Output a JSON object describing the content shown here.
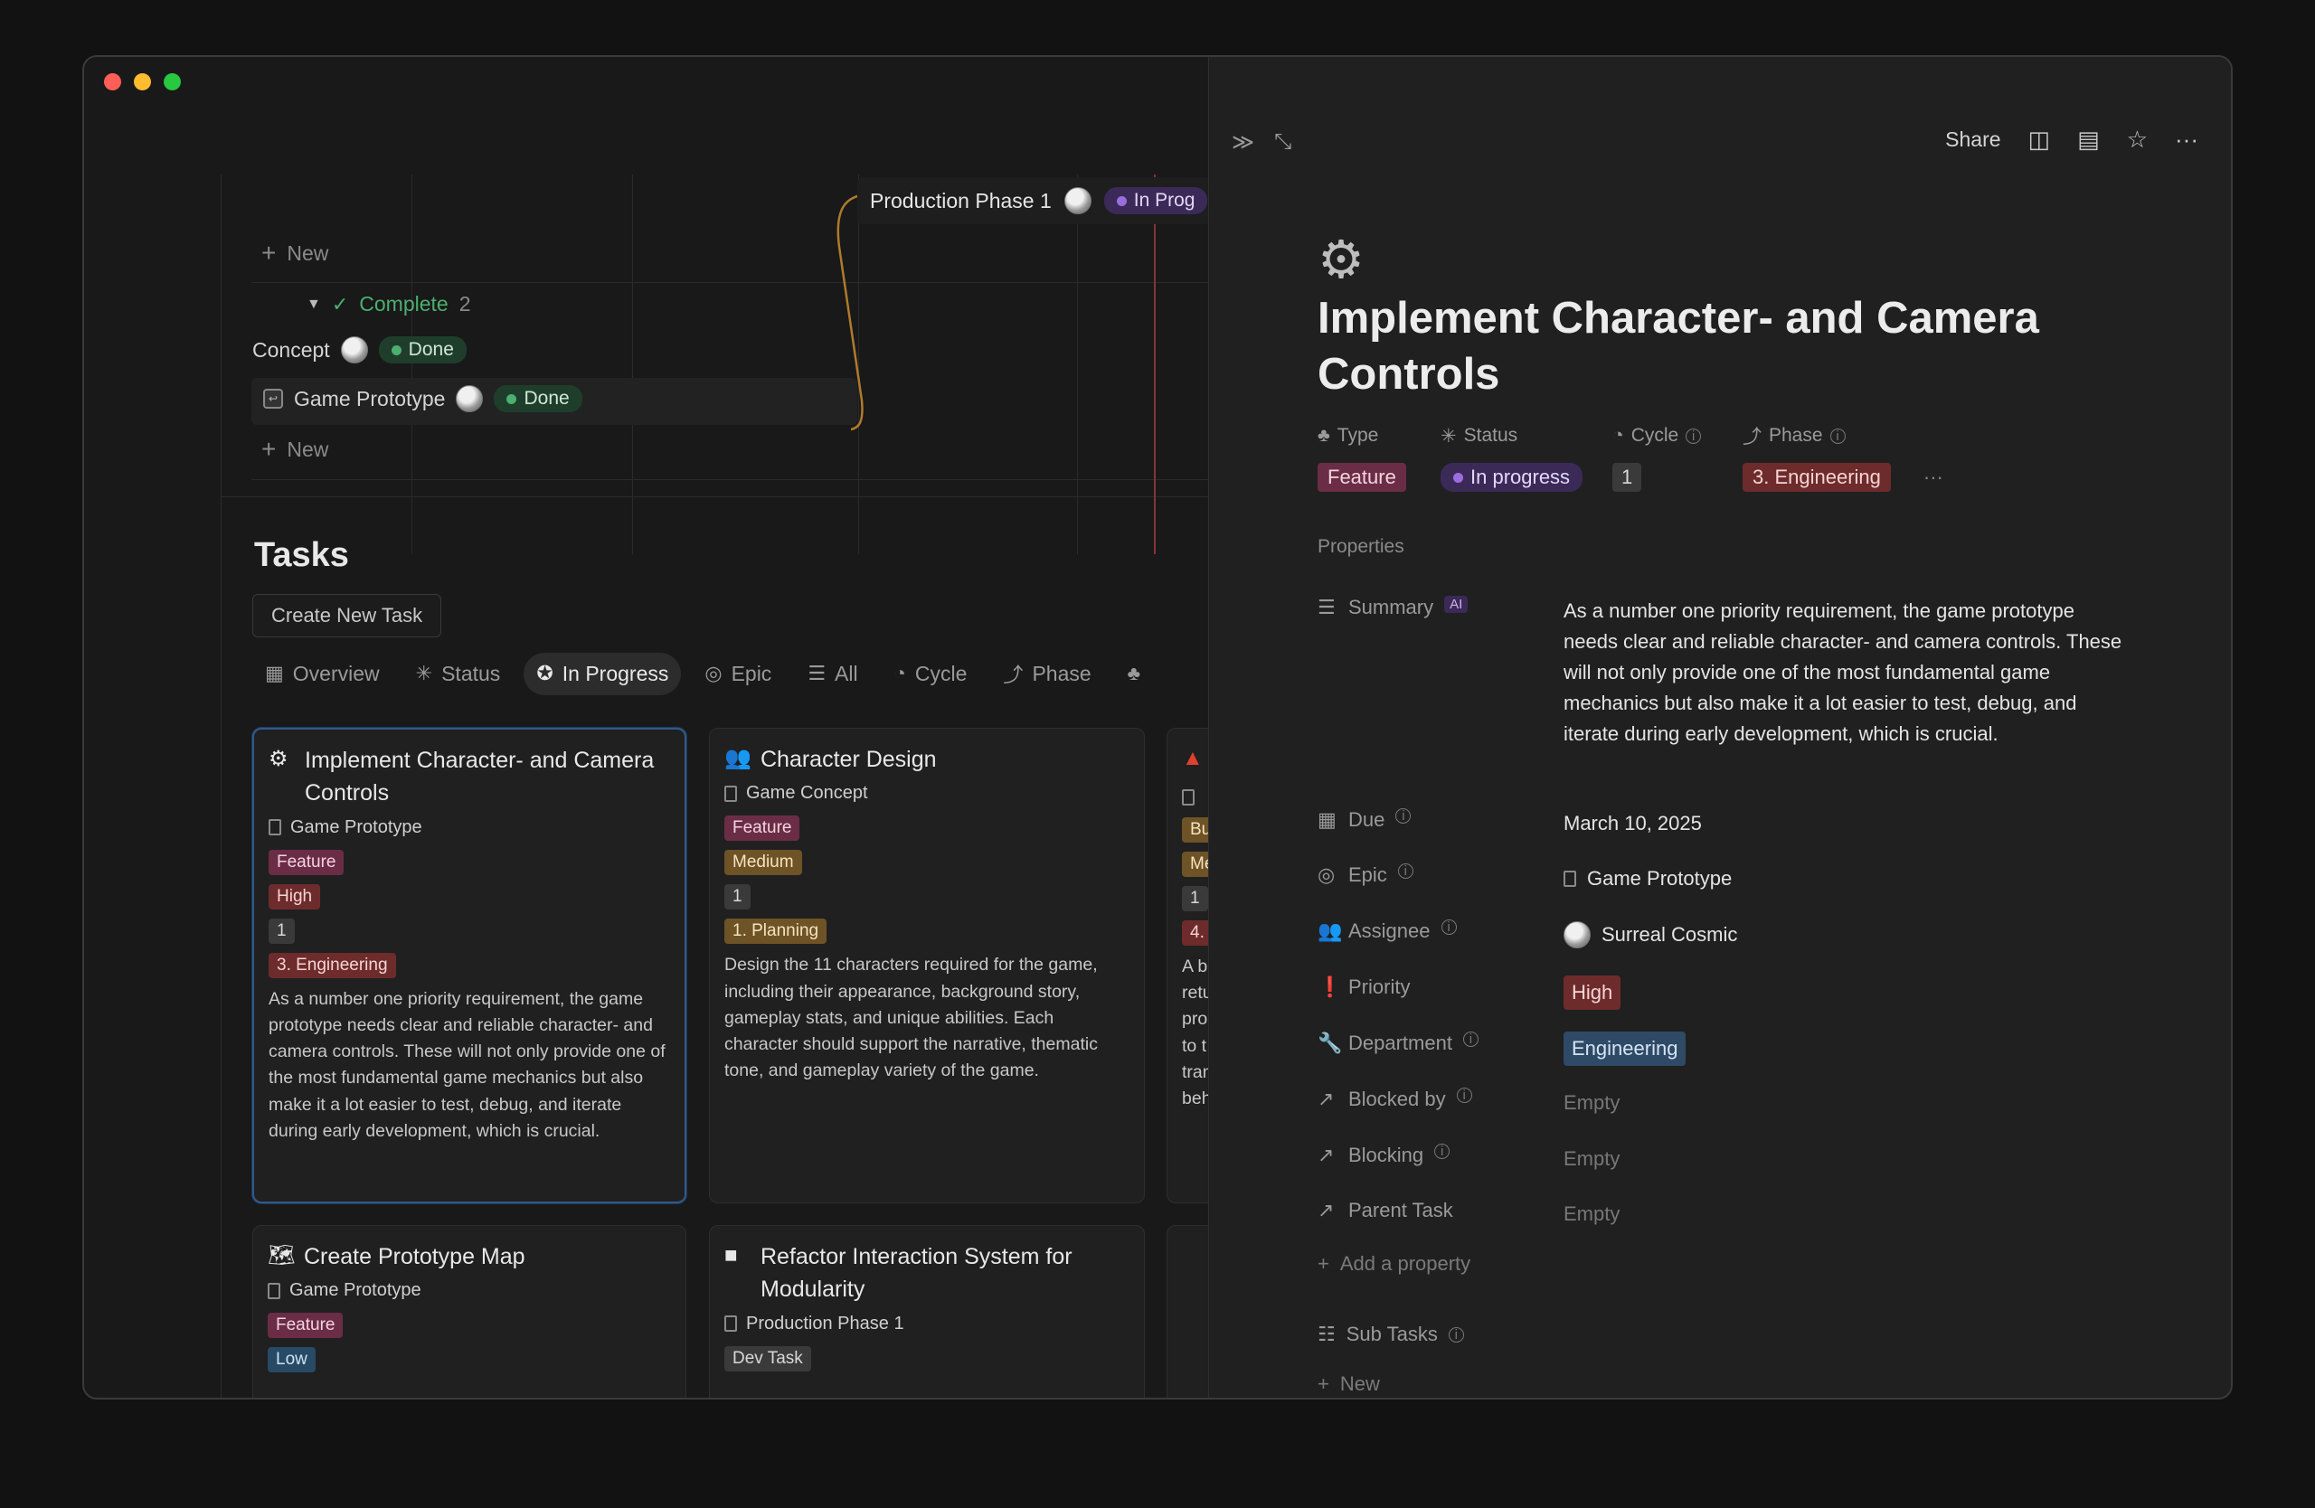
{
  "timeline": {
    "new_label_top": "New",
    "group_label": "Complete",
    "group_count": "2",
    "rows": [
      {
        "name": "Concept",
        "status": "Done"
      },
      {
        "name": "Game Prototype",
        "status": "Done"
      }
    ],
    "new_label_bottom": "New",
    "phase_card": {
      "name": "Production Phase 1",
      "status": "In Prog"
    }
  },
  "tasks": {
    "title": "Tasks",
    "create_button": "Create New Task",
    "tabs": [
      {
        "label": "Overview",
        "icon": "grid-icon"
      },
      {
        "label": "Status",
        "icon": "loading-icon"
      },
      {
        "label": "In Progress",
        "icon": "star-circle-icon"
      },
      {
        "label": "Epic",
        "icon": "target-icon"
      },
      {
        "label": "All",
        "icon": "list-icon"
      },
      {
        "label": "Cycle",
        "icon": "cycle-icon"
      },
      {
        "label": "Phase",
        "icon": "phase-icon"
      }
    ],
    "cards": [
      {
        "title": "Implement Character- and Camera Controls",
        "epic": "Game Prototype",
        "type": "Feature",
        "priority": "High",
        "cycle": "1",
        "phase": "3. Engineering",
        "description": "As a number one priority requirement, the game prototype needs clear and reliable character- and camera controls. These will not only provide one of the most fundamental game mechanics but also make it a lot easier to test, debug, and iterate during early development, which is crucial."
      },
      {
        "title": "Character Design",
        "epic": "Game Concept",
        "type": "Feature",
        "priority": "Medium",
        "cycle": "1",
        "phase": "1. Planning",
        "description": "Design the 11 characters required for the game, including their appearance, background story, gameplay stats, and unique abilities. Each character should support the narrative, thematic tone, and gameplay variety of the game."
      },
      {
        "title_visible": "",
        "tag1": "Bu",
        "tag2": "Me",
        "cycle": "1",
        "phase": "4.",
        "desc_lines": [
          "A b",
          "retu",
          "pro",
          "to t",
          "tran",
          "beh"
        ]
      },
      {
        "title": "Create Prototype Map",
        "epic": "Game Prototype",
        "type": "Feature",
        "priority": "Low"
      },
      {
        "title": "Refactor Interaction System for Modularity",
        "epic": "Production Phase 1",
        "type": "Dev Task"
      }
    ]
  },
  "detail": {
    "actions": {
      "share": "Share"
    },
    "title": "Implement Character- and Camera Controls",
    "header_props": {
      "type_label": "Type",
      "type_value": "Feature",
      "status_label": "Status",
      "status_value": "In progress",
      "cycle_label": "Cycle",
      "cycle_value": "1",
      "phase_label": "Phase",
      "phase_value": "3. Engineering"
    },
    "properties_heading": "Properties",
    "summary_label": "Summary",
    "summary_badge": "AI",
    "summary_value": "As a number one priority requirement, the game prototype needs clear and reliable character- and camera controls. These will not only provide one of the most fundamental game mechanics but also make it a lot easier to test, debug, and iterate during early development, which is crucial.",
    "due_label": "Due",
    "due_value": "March 10, 2025",
    "epic_label": "Epic",
    "epic_value": "Game Prototype",
    "assignee_label": "Assignee",
    "assignee_value": "Surreal Cosmic",
    "priority_label": "Priority",
    "priority_value": "High",
    "department_label": "Department",
    "department_value": "Engineering",
    "blocked_by_label": "Blocked by",
    "blocked_by_value": "Empty",
    "blocking_label": "Blocking",
    "blocking_value": "Empty",
    "parent_label": "Parent Task",
    "parent_value": "Empty",
    "add_property": "Add a property",
    "subtasks_label": "Sub Tasks",
    "subtasks_new": "New"
  },
  "colors": {
    "feature": "#6a2d45",
    "high": "#6e2b2b",
    "medium": "#6e5326",
    "low": "#274a66",
    "done": "#1f3d2b",
    "in_progress": "#3b2a57",
    "engineering": "#2f4a66"
  }
}
